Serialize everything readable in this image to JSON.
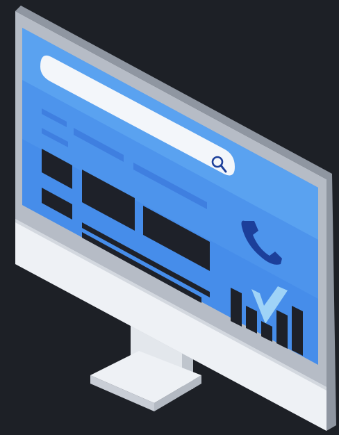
{
  "illustration": {
    "subject": "monitor",
    "icons": [
      "search-icon",
      "phone-icon",
      "checkmark-icon",
      "bar-chart-icon"
    ]
  },
  "colors": {
    "background": "#1d2026",
    "bezel": "#b6bcc6",
    "bezel_edge": "#8f96a1",
    "chin": "#eef1f5",
    "chin_shadow": "#c9ced6",
    "screen_light": "#6aaef2",
    "screen_band": "#4d94ec",
    "screen_dark": "#3d86e8",
    "header_band": "#5aa2f0",
    "search_bar": "#f3f6fa",
    "text_lines": "#3f7fe0",
    "blocks": "#1e2129",
    "phone": "#1c3f9a",
    "check": "#9fd3f7",
    "stand": "#e3e7ec",
    "stand_shadow": "#bfc5cd"
  }
}
